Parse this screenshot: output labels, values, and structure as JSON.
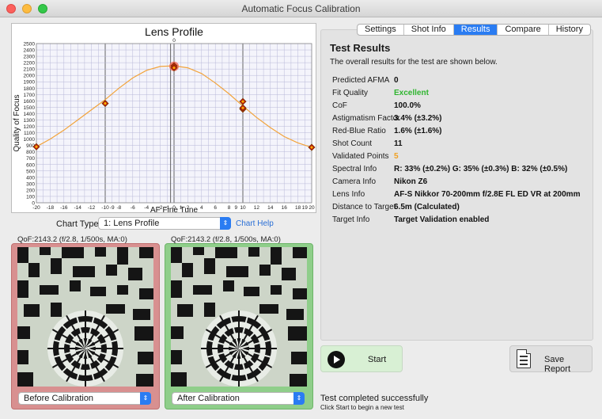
{
  "window": {
    "title": "Automatic Focus Calibration"
  },
  "chart_data": {
    "type": "line",
    "title": "Lens Profile",
    "xlabel": "AF Fine Tune",
    "ylabel": "Quality of Focus",
    "xlim": [
      -20,
      20
    ],
    "ylim": [
      0,
      2500
    ],
    "x_ticks": [
      "-20",
      "-18",
      "-16",
      "-14",
      "-12",
      "-10",
      "-9",
      "-8",
      "-6",
      "-4",
      "-2",
      "-1",
      "0",
      "1",
      "2",
      "4",
      "6",
      "8",
      "9",
      "10",
      "12",
      "14",
      "16",
      "18",
      "19",
      "20"
    ],
    "y_ticks": [
      "0",
      "100",
      "200",
      "300",
      "400",
      "500",
      "600",
      "700",
      "800",
      "900",
      "1000",
      "1100",
      "1200",
      "1300",
      "1400",
      "1500",
      "1600",
      "1700",
      "1800",
      "1900",
      "2000",
      "2100",
      "2200",
      "2300",
      "2400",
      "2500"
    ],
    "top_marker": "0",
    "series": [
      {
        "type": "curve",
        "x": [
          -20,
          -18,
          -16,
          -14,
          -12,
          -10,
          -8,
          -6,
          -4,
          -2,
          0,
          2,
          4,
          6,
          8,
          10,
          12,
          14,
          16,
          18,
          20
        ],
        "y": [
          880,
          1000,
          1140,
          1300,
          1460,
          1620,
          1800,
          1960,
          2080,
          2140,
          2150,
          2120,
          2030,
          1880,
          1710,
          1520,
          1340,
          1180,
          1040,
          940,
          870
        ]
      },
      {
        "type": "points",
        "x": [
          -20,
          -10,
          0,
          0,
          10,
          10,
          10,
          20
        ],
        "y": [
          880,
          1560,
          2150,
          2120,
          1590,
          1470,
          1490,
          870
        ]
      }
    ],
    "highlight": {
      "x": 0,
      "y": 2143
    }
  },
  "chart_type": {
    "label": "Chart Type",
    "value": "1: Lens Profile",
    "help": "Chart Help"
  },
  "before": {
    "qof": "QoF:2143.2 (f/2.8, 1/500s, MA:0)",
    "select": "Before Calibration"
  },
  "after": {
    "qof": "QoF:2143.2 (f/2.8, 1/500s, MA:0)",
    "select": "After Calibration"
  },
  "tabs": [
    "Settings",
    "Shot Info",
    "Results",
    "Compare",
    "History"
  ],
  "active_tab": "Results",
  "results": {
    "title": "Test Results",
    "description": "The overall results for the test are shown below.",
    "rows": [
      {
        "key": "Predicted AFMA",
        "value": "0",
        "color": "#111111"
      },
      {
        "key": "Fit Quality",
        "value": "Excellent",
        "color": "#2fb52f"
      },
      {
        "key": "CoF",
        "value": "100.0%",
        "color": "#111111"
      },
      {
        "key": "Astigmatism Factor",
        "value": "3.4% (±3.2%)",
        "color": "#111111"
      },
      {
        "key": "Red-Blue Ratio",
        "value": "1.6% (±1.6%)",
        "color": "#111111"
      },
      {
        "key": "Shot Count",
        "value": "11",
        "color": "#111111"
      },
      {
        "key": "Validated Points",
        "value": "5",
        "color": "#f0a020"
      },
      {
        "key": "Spectral Info",
        "value": "R: 33% (±0.2%) G: 35% (±0.3%) B: 32% (±0.5%)",
        "color": "#111111"
      },
      {
        "key": "Camera Info",
        "value": "Nikon Z6",
        "color": "#111111"
      },
      {
        "key": "Lens Info",
        "value": "AF-S Nikkor 70-200mm f/2.8E FL ED VR at 200mm",
        "color": "#111111"
      },
      {
        "key": "Distance to Target",
        "value": "6.5m (Calculated)",
        "color": "#111111"
      },
      {
        "key": "Target Info",
        "value": "Target Validation enabled",
        "color": "#111111"
      }
    ]
  },
  "buttons": {
    "start": "Start",
    "save": "Save Report"
  },
  "status": {
    "main": "Test completed successfully",
    "sub": "Click Start to begin a new test"
  },
  "icons": {
    "start": "play-icon",
    "save": "report-icon"
  }
}
